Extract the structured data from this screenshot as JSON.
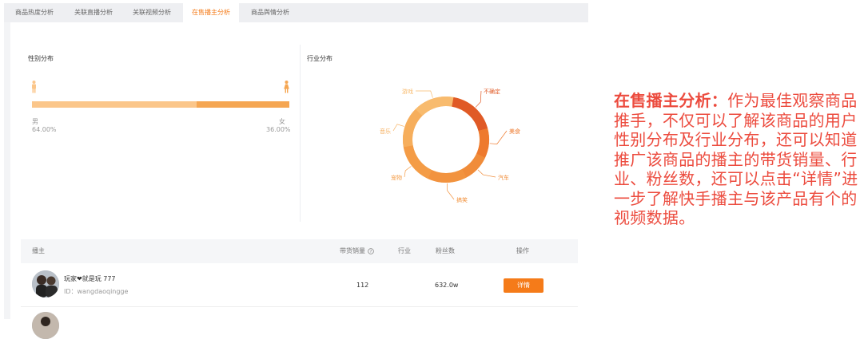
{
  "tabs": [
    {
      "label": "商品热度分析",
      "active": false
    },
    {
      "label": "关联直播分析",
      "active": false
    },
    {
      "label": "关联视频分析",
      "active": false
    },
    {
      "label": "在售播主分析",
      "active": true
    },
    {
      "label": "商品舆情分析",
      "active": false
    }
  ],
  "gender": {
    "title": "性别分布",
    "male_label": "男",
    "female_label": "女",
    "male_percent": "64.00%",
    "female_percent": "36.00%",
    "male_fraction": 0.64,
    "female_fraction": 0.36,
    "male_color": "#fbc68a",
    "female_color": "#f5a652",
    "male_icon": "male-person-icon",
    "female_icon": "female-person-icon"
  },
  "industry": {
    "title": "行业分布",
    "slices": [
      {
        "label": "不确定",
        "color": "#e05a26"
      },
      {
        "label": "美食",
        "color": "#ee7a2e"
      },
      {
        "label": "汽车",
        "color": "#f08c3a"
      },
      {
        "label": "搞笑",
        "color": "#f2933f"
      },
      {
        "label": "宠物",
        "color": "#f49c46"
      },
      {
        "label": "音乐",
        "color": "#f6ae5c"
      },
      {
        "label": "游戏",
        "color": "#f8bb6e"
      }
    ]
  },
  "table": {
    "headers": {
      "anchor": "播主",
      "sales": "带货销量",
      "industry": "行业",
      "fans": "粉丝数",
      "action": "操作"
    },
    "help_icon": "question-circle-icon",
    "rows": [
      {
        "name": "玩家❤就是玩 777",
        "id": "ID：wangdaoqingge",
        "sales": "112",
        "industry": "",
        "fans": "632.0w",
        "action": "详情"
      },
      {
        "name": "（部分可见）",
        "id": "",
        "sales": "",
        "industry": "",
        "fans": "",
        "action": ""
      }
    ]
  },
  "description": {
    "heading": "在售播主分析：",
    "body": "作为最佳观察商品推手，不仅可以了解该商品的用户性别分布及行业分布，还可以知道推广该商品的播主的带货销量、行业、粉丝数，还可以点击“详情”进一步了解快手播主与该产品有个的视频数据。"
  }
}
